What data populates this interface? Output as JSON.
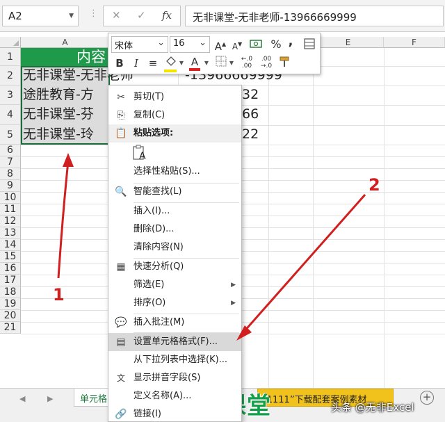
{
  "formula_bar": {
    "name_box": "A2",
    "cancel_glyph": "✕",
    "confirm_glyph": "✓",
    "fx_glyph": "fx",
    "content": "无非课堂-无非老师-13966669999"
  },
  "sheet": {
    "columns": [
      "A",
      "B",
      "C",
      "D",
      "E",
      "F"
    ],
    "rows": [
      "1",
      "2",
      "3",
      "4",
      "5",
      "6",
      "7",
      "8",
      "9",
      "10",
      "11",
      "12",
      "13",
      "14",
      "15",
      "16",
      "17",
      "18",
      "19",
      "20",
      "21"
    ],
    "header_cell": "内容",
    "cells": [
      {
        "a": "无非课堂-无非老师",
        "c": "-13966669999"
      },
      {
        "a": "途胜教育-方",
        "c": "32"
      },
      {
        "a": "无非课堂-芬",
        "c": "66"
      },
      {
        "a": "无非课堂-玲",
        "c": "22"
      }
    ],
    "header_color": "#1f9a4b"
  },
  "mini_toolbar": {
    "font_name": "宋体",
    "font_size": "16",
    "grow_font": "A",
    "shrink_font": "A",
    "percent": "%",
    "comma": ",",
    "bold": "B",
    "italic": "I",
    "font_color_letter": "A",
    "inc_decimal": "←.0 .00",
    "dec_decimal": ".00 →.0",
    "fill_color": "#f5e400",
    "font_color": "#e02020"
  },
  "context_menu": {
    "items": [
      {
        "icon": "✂",
        "label": "剪切(T)"
      },
      {
        "icon": "⎘",
        "label": "复制(C)"
      },
      {
        "icon": "📋",
        "label": "粘贴选项:"
      },
      {
        "icon": "",
        "label": "选择性粘贴(S)..."
      },
      {
        "icon": "🔍",
        "label": "智能查找(L)"
      },
      {
        "icon": "",
        "label": "插入(I)..."
      },
      {
        "icon": "",
        "label": "删除(D)..."
      },
      {
        "icon": "",
        "label": "清除内容(N)"
      },
      {
        "icon": "▦",
        "label": "快速分析(Q)"
      },
      {
        "icon": "",
        "label": "筛选(E)"
      },
      {
        "icon": "",
        "label": "排序(O)"
      },
      {
        "icon": "💬",
        "label": "插入批注(M)"
      },
      {
        "icon": "▤",
        "label": "设置单元格格式(F)..."
      },
      {
        "icon": "",
        "label": "从下拉列表中选择(K)..."
      },
      {
        "icon": "文",
        "label": "显示拼音字段(S)"
      },
      {
        "icon": "",
        "label": "定义名称(A)..."
      },
      {
        "icon": "🔗",
        "label": "链接(I)"
      }
    ],
    "submenu_arrow": "▶",
    "paste_icon_letter": "A"
  },
  "tabs": {
    "sheet_tab": "单元格",
    "banner": "“1111”下载配套案例素材",
    "add_sheet": "+",
    "nav_prev": "◀",
    "nav_next": "▶"
  },
  "watermark": {
    "logo": "无非课堂",
    "credit": "头条 @无非Excel"
  },
  "annotations": {
    "label_1": "1",
    "label_2": "2",
    "color": "#d11e1e"
  }
}
